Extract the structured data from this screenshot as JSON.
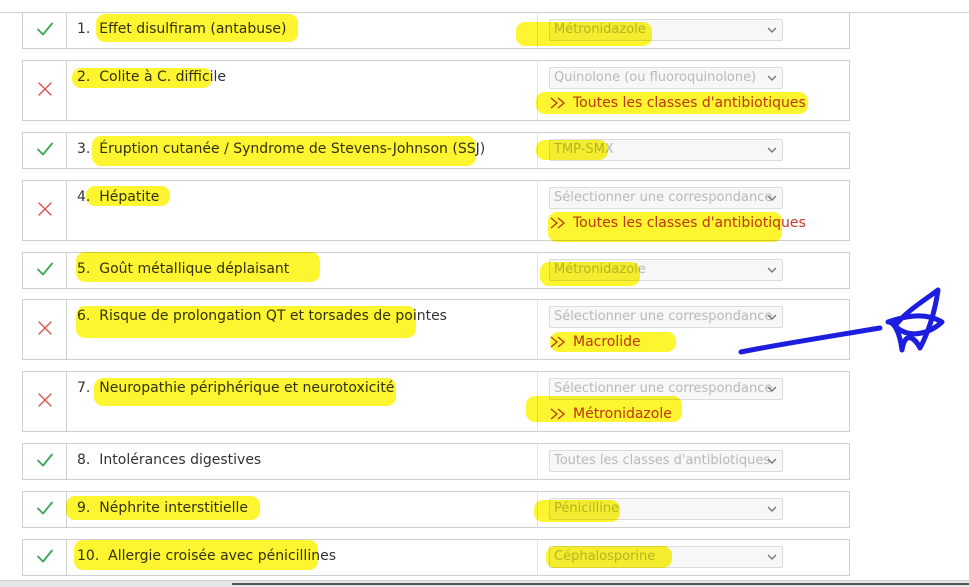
{
  "colors": {
    "correct": "#3aa757",
    "incorrect": "#d9534f",
    "answer_text": "#c0392b",
    "highlighter": "#fcf40b",
    "pen": "#1d1de0"
  },
  "rows": [
    {
      "number": "1.",
      "text": "Effet disulfiram (antabuse)",
      "status": "correct",
      "mark_icon": "checkmark-icon",
      "selected": "Métronidazole",
      "answer": ""
    },
    {
      "number": "2.",
      "text": "Colite à C. difficile",
      "status": "incorrect",
      "mark_icon": "cross-icon",
      "selected": "Quinolone (ou fluoroquinolone)",
      "answer": "Toutes les classes d'antibiotiques"
    },
    {
      "number": "3.",
      "text": "Éruption cutanée / Syndrome de Stevens-Johnson (SSJ)",
      "status": "correct",
      "mark_icon": "checkmark-icon",
      "selected": "TMP-SMX",
      "answer": ""
    },
    {
      "number": "4.",
      "text": "Hépatite",
      "status": "incorrect",
      "mark_icon": "cross-icon",
      "selected": "Sélectionner une correspondance",
      "answer": "Toutes les classes d'antibiotiques"
    },
    {
      "number": "5.",
      "text": "Goût métallique déplaisant",
      "status": "correct",
      "mark_icon": "checkmark-icon",
      "selected": "Métronidazole",
      "answer": ""
    },
    {
      "number": "6.",
      "text": "Risque de prolongation QT et torsades de pointes",
      "status": "incorrect",
      "mark_icon": "cross-icon",
      "selected": "Sélectionner une correspondance",
      "answer": "Macrolide"
    },
    {
      "number": "7.",
      "text": "Neuropathie périphérique et neurotoxicité",
      "status": "incorrect",
      "mark_icon": "cross-icon",
      "selected": "Sélectionner une correspondance",
      "answer": "Métronidazole"
    },
    {
      "number": "8.",
      "text": "Intolérances digestives",
      "status": "correct",
      "mark_icon": "checkmark-icon",
      "selected": "Toutes les classes d'antibiotiques",
      "answer": ""
    },
    {
      "number": "9.",
      "text": "Néphrite interstitielle",
      "status": "correct",
      "mark_icon": "checkmark-icon",
      "selected": "Pénicilline",
      "answer": ""
    },
    {
      "number": "10.",
      "text": "Allergie croisée avec pénicillines",
      "status": "correct",
      "mark_icon": "checkmark-icon",
      "selected": "Céphalosporine",
      "answer": ""
    }
  ]
}
